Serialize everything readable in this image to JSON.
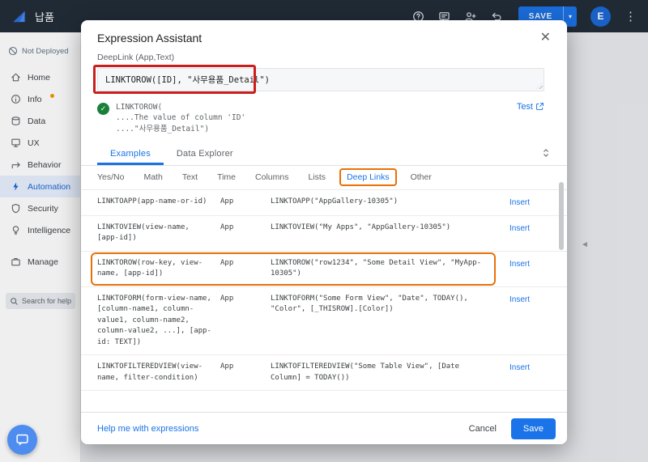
{
  "topbar": {
    "app_name": "납품",
    "icons": [
      "help",
      "feedback",
      "share",
      "undo"
    ],
    "save_label": "SAVE",
    "avatar_initial": "E"
  },
  "sidebar": {
    "deploy_badge": "Not Deployed",
    "search_placeholder": "Search for help",
    "items": [
      {
        "label": "Home",
        "icon": "home"
      },
      {
        "label": "Info",
        "icon": "info",
        "dot": true
      },
      {
        "label": "Data",
        "icon": "data"
      },
      {
        "label": "UX",
        "icon": "ux"
      },
      {
        "label": "Behavior",
        "icon": "behavior"
      },
      {
        "label": "Automation",
        "icon": "automation",
        "active": true
      },
      {
        "label": "Security",
        "icon": "security"
      },
      {
        "label": "Intelligence",
        "icon": "intelligence"
      },
      {
        "label": "Manage",
        "icon": "manage",
        "group": "bottom"
      }
    ]
  },
  "modal": {
    "title": "Expression Assistant",
    "close_label": "✕",
    "field_label": "DeepLink (App,Text)",
    "expression_value": "LINKTOROW([ID], \"사무용품_Detail\")",
    "validation": {
      "lines": [
        "LINKTOROW(",
        "....The value of column 'ID'",
        "....\"사무용품_Detail\")"
      ],
      "test_label": "Test"
    },
    "tabs": [
      {
        "label": "Examples",
        "active": true
      },
      {
        "label": "Data Explorer",
        "active": false
      }
    ],
    "categories": [
      "Yes/No",
      "Math",
      "Text",
      "Time",
      "Columns",
      "Lists",
      "Deep Links",
      "Other"
    ],
    "active_category": "Deep Links",
    "rows": [
      {
        "signature": "LINKTOAPP(app-name-or-id)",
        "type": "App",
        "example": "LINKTOAPP(\"AppGallery-10305\")",
        "insert": "Insert"
      },
      {
        "signature": "LINKTOVIEW(view-name, [app-id])",
        "type": "App",
        "example": "LINKTOVIEW(\"My Apps\", \"AppGallery-10305\")",
        "insert": "Insert"
      },
      {
        "signature": "LINKTOROW(row-key, view-name, [app-id])",
        "type": "App",
        "example": "LINKTOROW(\"row1234\", \"Some Detail View\", \"MyApp-10305\")",
        "insert": "Insert",
        "highlighted": true
      },
      {
        "signature": "LINKTOFORM(form-view-name, [column-name1, column-value1, column-name2, column-value2, ...], [app-id: TEXT])",
        "type": "App",
        "example": "LINKTOFORM(\"Some Form View\", \"Date\", TODAY(), \"Color\", [_THISROW].[Color])",
        "insert": "Insert"
      },
      {
        "signature": "LINKTOFILTEREDVIEW(view-name, filter-condition)",
        "type": "App",
        "example": "LINKTOFILTEREDVIEW(\"Some Table View\", [Date Column] = TODAY())",
        "insert": "Insert"
      }
    ],
    "footer": {
      "help_link": "Help me with expressions",
      "cancel_label": "Cancel",
      "save_label": "Save"
    }
  },
  "colors": {
    "accent_blue": "#1a73e8",
    "annotation_red": "#c9201d",
    "annotation_orange": "#e8710a",
    "success_green": "#188038"
  }
}
